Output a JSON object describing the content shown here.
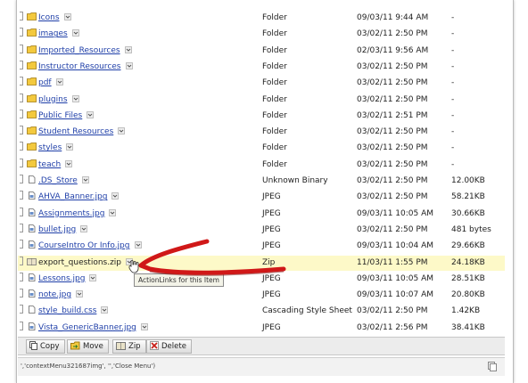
{
  "files": [
    {
      "name": "Icons",
      "type": "Folder",
      "date": "09/03/11 9:44 AM",
      "size": "-",
      "icon": "folder-icon"
    },
    {
      "name": "images",
      "type": "Folder",
      "date": "03/02/11 2:50 PM",
      "size": "-",
      "icon": "folder-icon"
    },
    {
      "name": "Imported_Resources",
      "type": "Folder",
      "date": "02/03/11 9:56 AM",
      "size": "-",
      "icon": "folder-icon"
    },
    {
      "name": "Instructor Resources",
      "type": "Folder",
      "date": "03/02/11 2:50 PM",
      "size": "-",
      "icon": "folder-icon"
    },
    {
      "name": "pdf",
      "type": "Folder",
      "date": "03/02/11 2:50 PM",
      "size": "-",
      "icon": "folder-icon"
    },
    {
      "name": "plugins",
      "type": "Folder",
      "date": "03/02/11 2:50 PM",
      "size": "-",
      "icon": "folder-icon"
    },
    {
      "name": "Public Files",
      "type": "Folder",
      "date": "03/02/11 2:51 PM",
      "size": "-",
      "icon": "folder-icon"
    },
    {
      "name": "Student Resources",
      "type": "Folder",
      "date": "03/02/11 2:50 PM",
      "size": "-",
      "icon": "folder-icon"
    },
    {
      "name": "styles",
      "type": "Folder",
      "date": "03/02/11 2:50 PM",
      "size": "-",
      "icon": "folder-icon"
    },
    {
      "name": "teach",
      "type": "Folder",
      "date": "03/02/11 2:50 PM",
      "size": "-",
      "icon": "folder-icon"
    },
    {
      "name": ".DS_Store",
      "type": "Unknown Binary",
      "date": "03/02/11 2:50 PM",
      "size": "12.00KB",
      "icon": "file-icon"
    },
    {
      "name": "AHVA_Banner.jpg",
      "type": "JPEG",
      "date": "03/02/11 2:50 PM",
      "size": "58.21KB",
      "icon": "image-file-icon"
    },
    {
      "name": "Assignments.jpg",
      "type": "JPEG",
      "date": "09/03/11 10:05 AM",
      "size": "30.66KB",
      "icon": "image-file-icon"
    },
    {
      "name": "bullet.jpg",
      "type": "JPEG",
      "date": "03/02/11 2:50 PM",
      "size": "481 bytes",
      "icon": "image-file-icon"
    },
    {
      "name": "CourseIntro Or Info.jpg",
      "type": "JPEG",
      "date": "09/03/11 10:04 AM",
      "size": "29.66KB",
      "icon": "image-file-icon"
    },
    {
      "name": "export_questions.zip",
      "type": "Zip",
      "date": "11/03/11 1:55 PM",
      "size": "24.18KB",
      "icon": "zip-file-icon"
    },
    {
      "name": "Lessons.jpg",
      "type": "JPEG",
      "date": "09/03/11 10:05 AM",
      "size": "28.51KB",
      "icon": "image-file-icon"
    },
    {
      "name": "note.jpg",
      "type": "JPEG",
      "date": "09/03/11 10:07 AM",
      "size": "20.80KB",
      "icon": "image-file-icon"
    },
    {
      "name": "style_build.css",
      "type": "Cascading Style Sheet",
      "date": "03/02/11 2:50 PM",
      "size": "1.42KB",
      "icon": "file-icon"
    },
    {
      "name": "Vista_GenericBanner.jpg",
      "type": "JPEG",
      "date": "03/02/11 2:56 PM",
      "size": "38.41KB",
      "icon": "image-file-icon"
    }
  ],
  "tooltip": "ActionLinks for this Item",
  "toolbar": {
    "copy_label": "Copy",
    "move_label": "Move",
    "zip_label": "Zip",
    "delete_label": "Delete"
  },
  "status": {
    "text": "','contextMenu321687img', '','Close Menu')"
  },
  "colors": {
    "link": "#1f3fa8",
    "highlight_row": "#fdf9c8",
    "annotation_arrow": "#d01818",
    "folder": "#f3c93e"
  }
}
